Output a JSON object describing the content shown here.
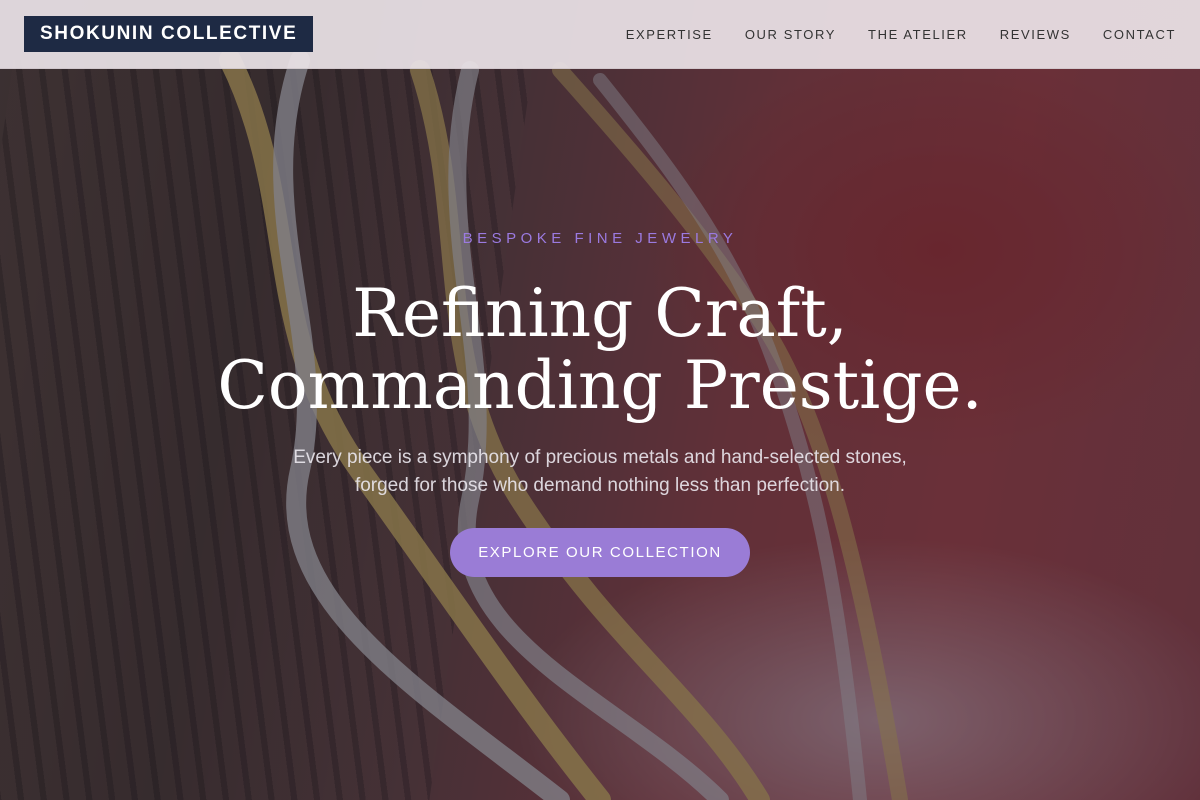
{
  "nav": {
    "brand": "SHOKUNIN COLLECTIVE",
    "links": [
      "EXPERTISE",
      "OUR STORY",
      "THE ATELIER",
      "REVIEWS",
      "CONTACT"
    ]
  },
  "hero": {
    "eyebrow": "BESPOKE FINE JEWELRY",
    "headline_line1": "Refining Craft,",
    "headline_line2": "Commanding Prestige.",
    "subtext": "Every piece is a symphony of precious metals and hand-selected stones, forged for those who demand nothing less than perfection.",
    "cta_label": "EXPLORE OUR COLLECTION",
    "image": "gold-and-silver-twisted-bangles-photo"
  },
  "colors": {
    "brand_bg": "#1e2a44",
    "accent": "#9a7cd6",
    "eyebrow": "#9b7ae0",
    "nav_bg": "#ece4e8"
  }
}
